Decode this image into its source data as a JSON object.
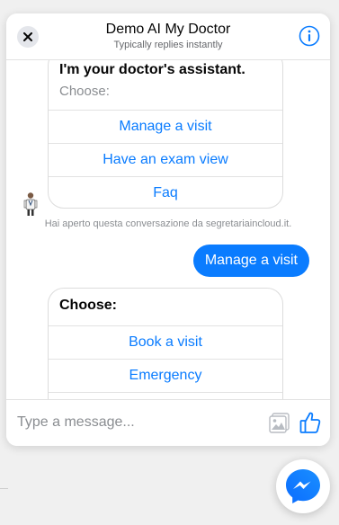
{
  "header": {
    "title": "Demo AI My Doctor",
    "subtitle": "Typically replies instantly",
    "close_icon": "close-icon",
    "info_icon": "info-icon"
  },
  "messages": {
    "card_1": {
      "title": "I'm your doctor's assistant.",
      "subtitle": "Choose:",
      "buttons": [
        "Manage a visit",
        "Have an exam view",
        "Faq"
      ]
    },
    "system_note": "Hai aperto questa conversazione da segretariaincloud.it.",
    "user_message": "Manage a visit",
    "card_2": {
      "title": "Choose:",
      "buttons": [
        "Book a visit",
        "Emergency"
      ]
    },
    "avatar_icon": "doctor-avatar-icon"
  },
  "composer": {
    "placeholder": "Type a message...",
    "image_icon": "image-icon",
    "like_icon": "thumbs-up-icon"
  },
  "launcher": {
    "icon": "messenger-icon"
  },
  "colors": {
    "accent": "#0a7cff",
    "bubble_text": "#ffffff",
    "muted_text": "#8a8d91"
  }
}
